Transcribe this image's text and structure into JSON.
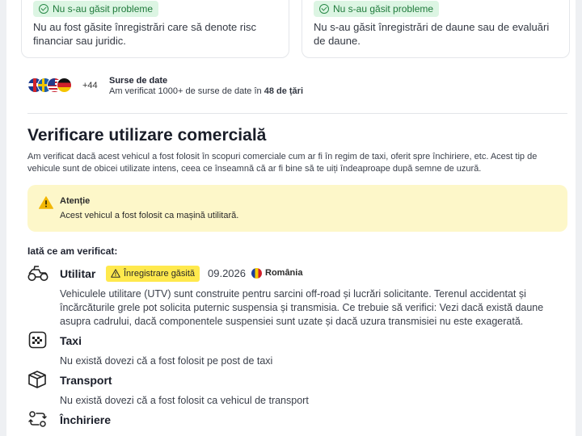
{
  "cards": [
    {
      "badge": "Nu s-au găsit probleme",
      "text": "Nu au fost găsite înregistrări care să denote risc financiar sau juridic."
    },
    {
      "badge": "Nu s-au găsit probleme",
      "text": "Nu s-au găsit înregistrări de daune sau de evaluări de daune."
    }
  ],
  "sources": {
    "flags": [
      "uk-flag",
      "sweden-flag",
      "usa-flag",
      "germany-flag"
    ],
    "more_count": "+44",
    "title": "Surse de date",
    "subtitle_prefix": "Am verificat 1000+ de surse de date în ",
    "subtitle_bold": "48 de țări"
  },
  "commercial": {
    "title": "Verificare utilizare comercială",
    "description": "Am verificat dacă acest vehicul a fost folosit în scopuri comerciale cum ar fi în regim de taxi, oferit spre închiriere, etc. Acest tip de vehicule sunt de obicei utilizate intens, ceea ce înseamnă că ar fi bine să te uiți îndeaproape după semne de uzură.",
    "alert": {
      "title": "Atenție",
      "text": "Acest vehicul a fost folosit ca mașină utilitară."
    },
    "checked_label": "Iată ce am verificat:",
    "items": [
      {
        "icon": "utv-icon",
        "name": "Utilitar",
        "badge": "Înregistrare găsită",
        "date": "09.2026",
        "country": "România",
        "description": "Vehiculele utilitare (UTV) sunt construite pentru sarcini off-road și lucrări solicitante. Terenul accidentat și încărcăturile grele pot solicita puternic suspensia și transmisia. Ce trebuie să verifici: Vezi dacă există daune asupra cadrului, dacă componentele suspensiei sunt uzate și dacă uzura transmisiei nu este exagerată."
      },
      {
        "icon": "taxi-icon",
        "name": "Taxi",
        "description": "Nu există dovezi că a fost folosit pe post de taxi"
      },
      {
        "icon": "box-icon",
        "name": "Transport",
        "description": "Nu există dovezi că a fost folosit ca vehicul de transport"
      },
      {
        "icon": "rental-icon",
        "name": "Închiriere",
        "description": ""
      }
    ]
  },
  "colors": {
    "ok_badge_bg": "#dcf5e3",
    "ok_badge_text": "#1f7a3b",
    "alert_bg": "#fdf7c9",
    "found_badge_bg": "#ffe94d",
    "warning_icon": "#f2b705"
  }
}
